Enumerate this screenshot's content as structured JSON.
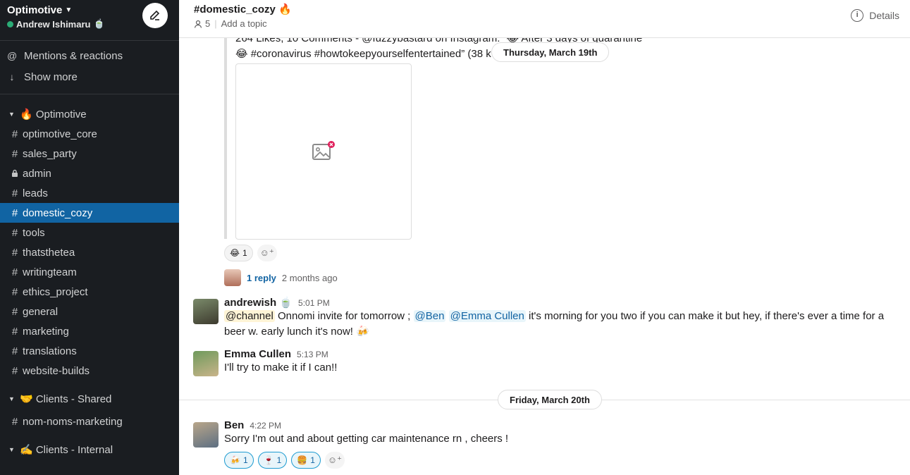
{
  "workspace": {
    "name": "Optimotive",
    "user": "Andrew Ishimaru",
    "user_status_emoji": "🍵"
  },
  "sidebar": {
    "top_links": [
      {
        "icon": "at-icon",
        "glyph": "@",
        "label": "Mentions & reactions"
      },
      {
        "icon": "arrow-down-icon",
        "glyph": "↓",
        "label": "Show more"
      }
    ],
    "sections": [
      {
        "label": "🔥 Optimotive",
        "channels": [
          {
            "prefix": "#",
            "name": "optimotive_core"
          },
          {
            "prefix": "#",
            "name": "sales_party"
          },
          {
            "prefix": "lock",
            "name": "admin"
          },
          {
            "prefix": "#",
            "name": "leads"
          },
          {
            "prefix": "#",
            "name": "domestic_cozy",
            "active": true
          },
          {
            "prefix": "#",
            "name": "tools"
          },
          {
            "prefix": "#",
            "name": "thatsthetea"
          },
          {
            "prefix": "#",
            "name": "writingteam"
          },
          {
            "prefix": "#",
            "name": "ethics_project"
          },
          {
            "prefix": "#",
            "name": "general"
          },
          {
            "prefix": "#",
            "name": "marketing"
          },
          {
            "prefix": "#",
            "name": "translations"
          },
          {
            "prefix": "#",
            "name": "website-builds"
          }
        ]
      },
      {
        "label": "🤝 Clients - Shared",
        "channels": [
          {
            "prefix": "#",
            "name": "nom-noms-marketing"
          }
        ]
      },
      {
        "label": "✍️ Clients - Internal",
        "channels": []
      }
    ]
  },
  "header": {
    "title": "#domestic_cozy 🔥",
    "member_count": "5",
    "topic_placeholder": "Add a topic",
    "details_label": "Details"
  },
  "messages": {
    "quote_line1": "264 Likes, 10 Comments - @fuzzybastard on Instagram: “😂 After 3 days of quarantine",
    "quote_line2": "😂 #coronavirus #howtokeepyourselfentertained” (38 k",
    "day1": "Thursday, March 19th",
    "reaction1": {
      "emoji": "😂",
      "count": "1"
    },
    "thread_reply": "1 reply",
    "thread_ago": "2 months ago",
    "andrewish": {
      "author": "andrewish 🍵",
      "time": "5:01 PM",
      "channel_mention": "@channel",
      "text_a": " Onnomi invite for tomorrow ; ",
      "mention1": "@Ben",
      "mention2": "@Emma Cullen",
      "text_b": " it's morning for you two if you can make it but hey, if there's ever a time for a beer w. early lunch it's now! 🍻"
    },
    "emma": {
      "author": "Emma Cullen",
      "time": "5:13 PM",
      "text": "I'll try to make it if I can!!"
    },
    "day2": "Friday, March 20th",
    "ben": {
      "author": "Ben",
      "time": "4:22 PM",
      "text": "Sorry I'm out and about getting car maintenance rn , cheers !",
      "reactions": [
        {
          "emoji": "🍻",
          "count": "1"
        },
        {
          "emoji": "🍷",
          "count": "1"
        },
        {
          "emoji": "🍔",
          "count": "1"
        }
      ]
    }
  }
}
